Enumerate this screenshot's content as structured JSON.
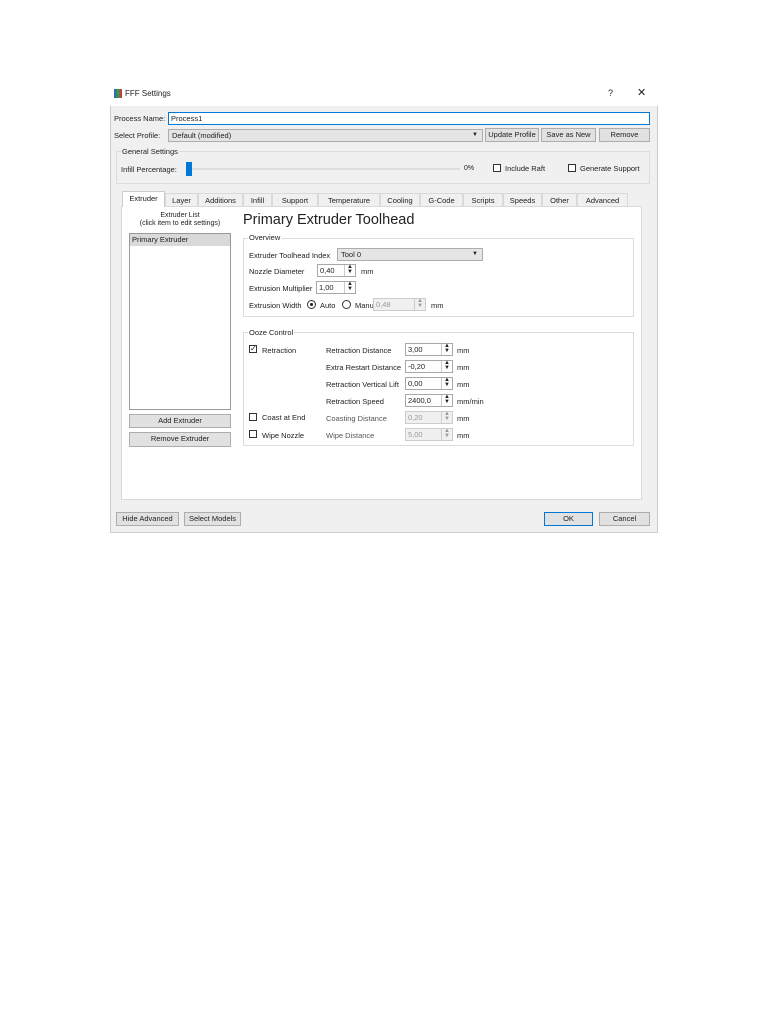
{
  "window": {
    "title": "FFF Settings",
    "help": "?",
    "close": "✕"
  },
  "process": {
    "label": "Process Name:",
    "value": "Process1"
  },
  "profile": {
    "label": "Select Profile:",
    "value": "Default (modified)",
    "update": "Update Profile",
    "save_new": "Save as New",
    "remove": "Remove"
  },
  "general": {
    "title": "General Settings",
    "infill_label": "Infill Percentage:",
    "infill_value": "0%",
    "infill_percent": 0,
    "include_raft": "Include Raft",
    "generate_support": "Generate Support"
  },
  "tabs": [
    "Extruder",
    "Layer",
    "Additions",
    "Infill",
    "Support",
    "Temperature",
    "Cooling",
    "G-Code",
    "Scripts",
    "Speeds",
    "Other",
    "Advanced"
  ],
  "extruder_list": {
    "title1": "Extruder List",
    "title2": "(click item to edit settings)",
    "items": [
      "Primary Extruder"
    ],
    "add": "Add Extruder",
    "remove": "Remove Extruder"
  },
  "heading": "Primary Extruder Toolhead",
  "overview": {
    "title": "Overview",
    "index_label": "Extruder Toolhead Index",
    "index_value": "Tool 0",
    "nozzle_label": "Nozzle Diameter",
    "nozzle_value": "0,40",
    "mult_label": "Extrusion Multiplier",
    "mult_value": "1,00",
    "width_label": "Extrusion Width",
    "auto": "Auto",
    "manual": "Manual",
    "width_value": "0,48",
    "mm": "mm"
  },
  "ooze": {
    "title": "Ooze Control",
    "retraction": "Retraction",
    "coast": "Coast at End",
    "wipe": "Wipe Nozzle",
    "rows": [
      {
        "label": "Retraction Distance",
        "value": "3,00",
        "unit": "mm"
      },
      {
        "label": "Extra Restart Distance",
        "value": "-0,20",
        "unit": "mm"
      },
      {
        "label": "Retraction Vertical Lift",
        "value": "0,00",
        "unit": "mm"
      },
      {
        "label": "Retraction Speed",
        "value": "2400,0",
        "unit": "mm/min"
      },
      {
        "label": "Coasting Distance",
        "value": "0,20",
        "unit": "mm"
      },
      {
        "label": "Wipe Distance",
        "value": "5,00",
        "unit": "mm"
      }
    ]
  },
  "footer": {
    "hide_advanced": "Hide Advanced",
    "select_models": "Select Models",
    "ok": "OK",
    "cancel": "Cancel"
  }
}
